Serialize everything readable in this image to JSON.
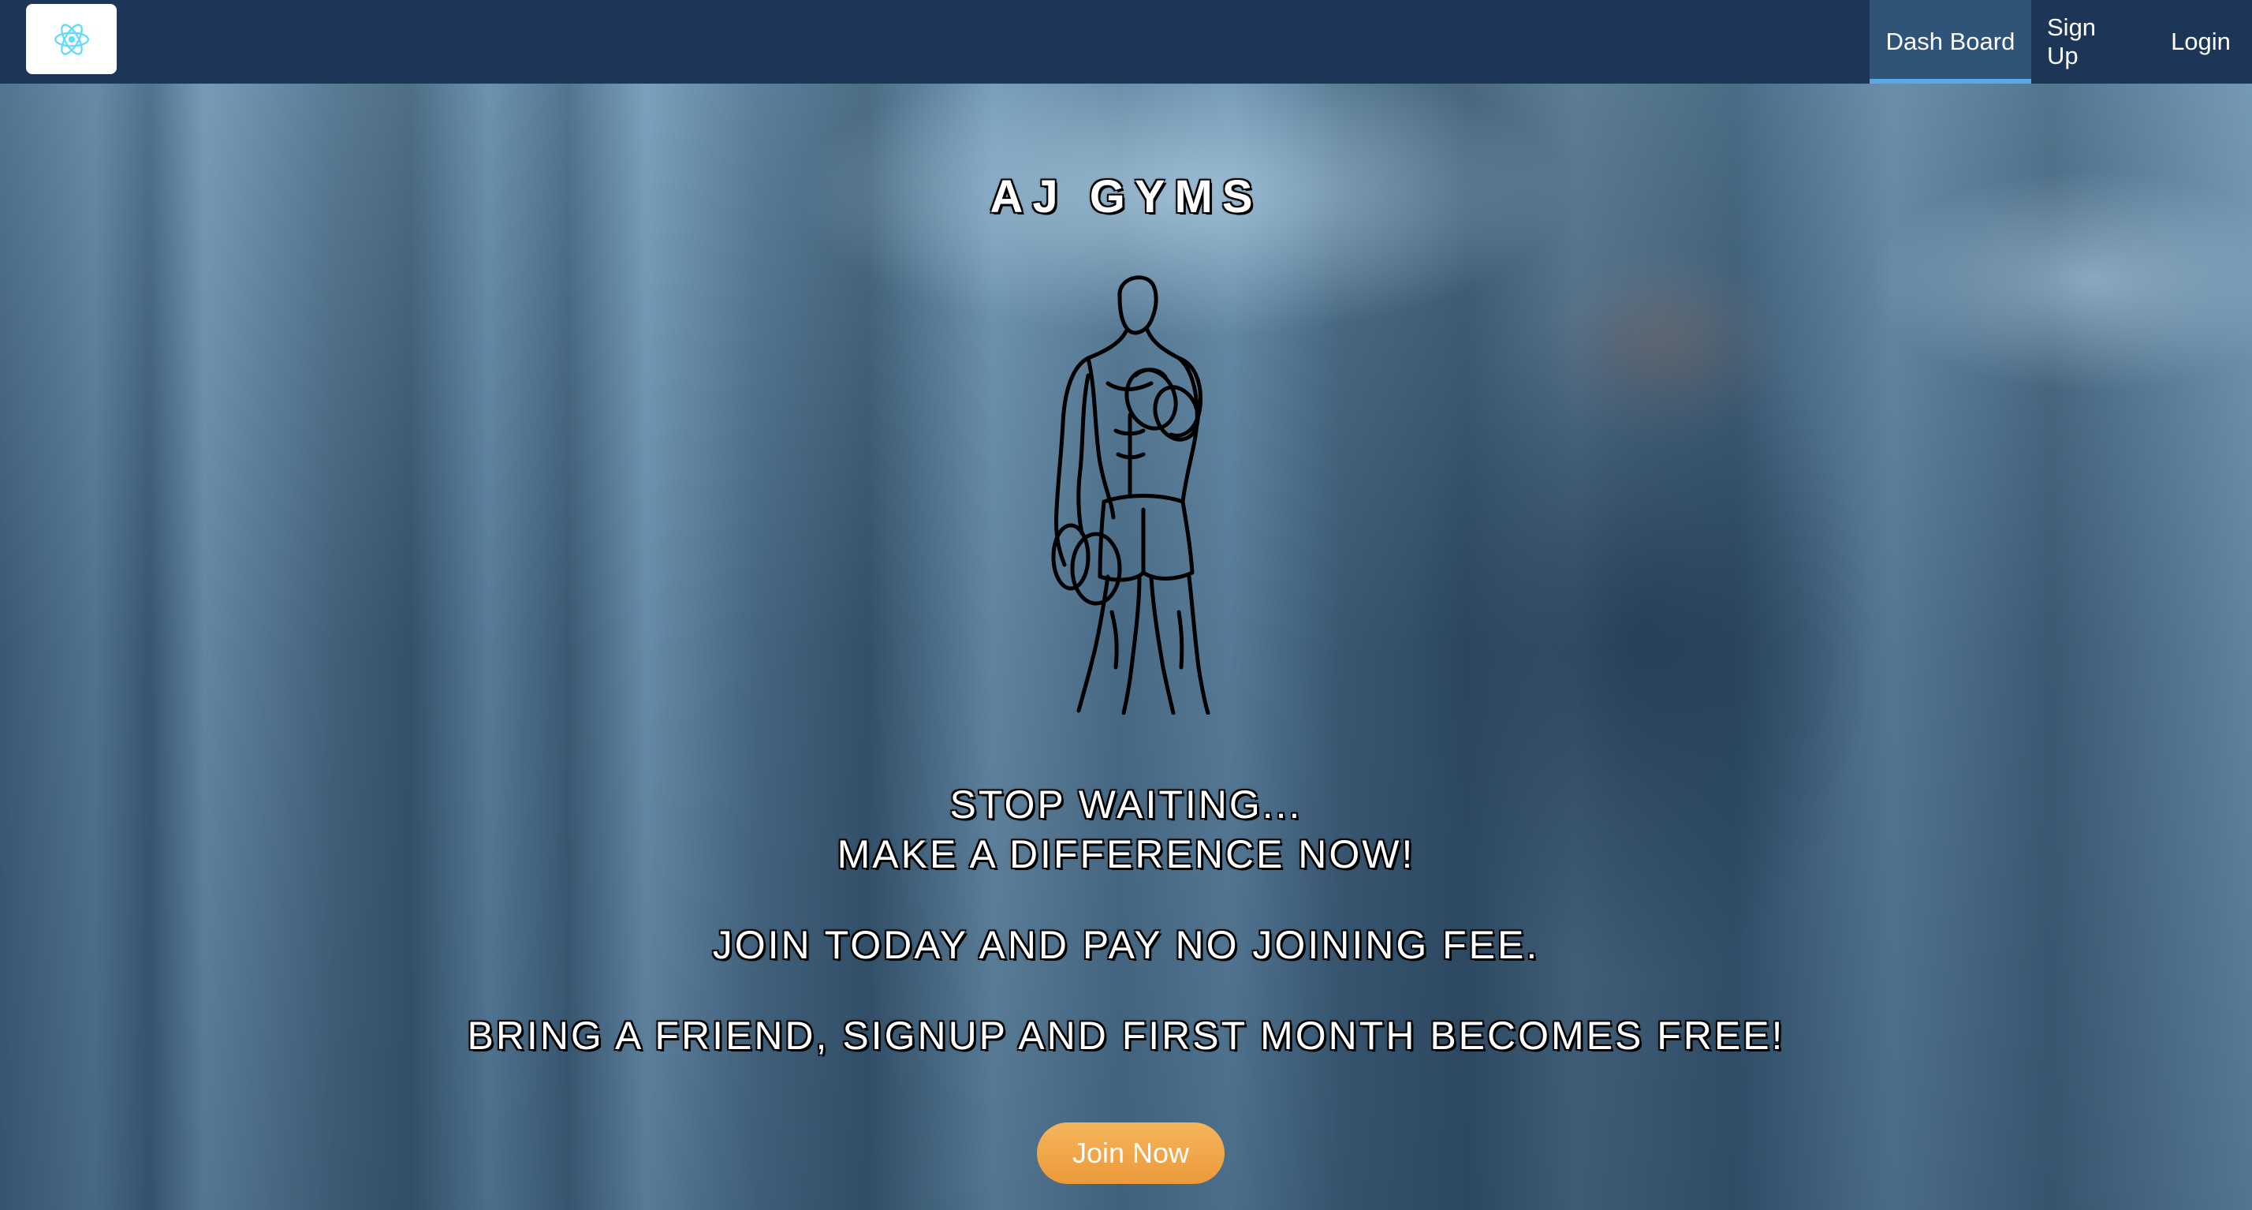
{
  "navbar": {
    "logo_icon": "react-atom-icon",
    "accent_color": "#61dafb",
    "background_color": "#1d3557",
    "links": [
      {
        "label": "Dash Board",
        "active": true
      },
      {
        "label": "Sign Up",
        "active": false
      },
      {
        "label": "Login",
        "active": false
      }
    ]
  },
  "hero": {
    "title": "AJ GYMS",
    "figure_icon": "bodybuilder-dumbbell-icon",
    "line1": "STOP WAITING...",
    "line2": "MAKE A DIFFERENCE NOW!",
    "line3": "JOIN TODAY AND PAY NO JOINING FEE.",
    "line4": "BRING A FRIEND, SIGNUP AND FIRST MONTH BECOMES FREE!",
    "cta_label": "Join Now",
    "cta_color": "#f0a444"
  }
}
